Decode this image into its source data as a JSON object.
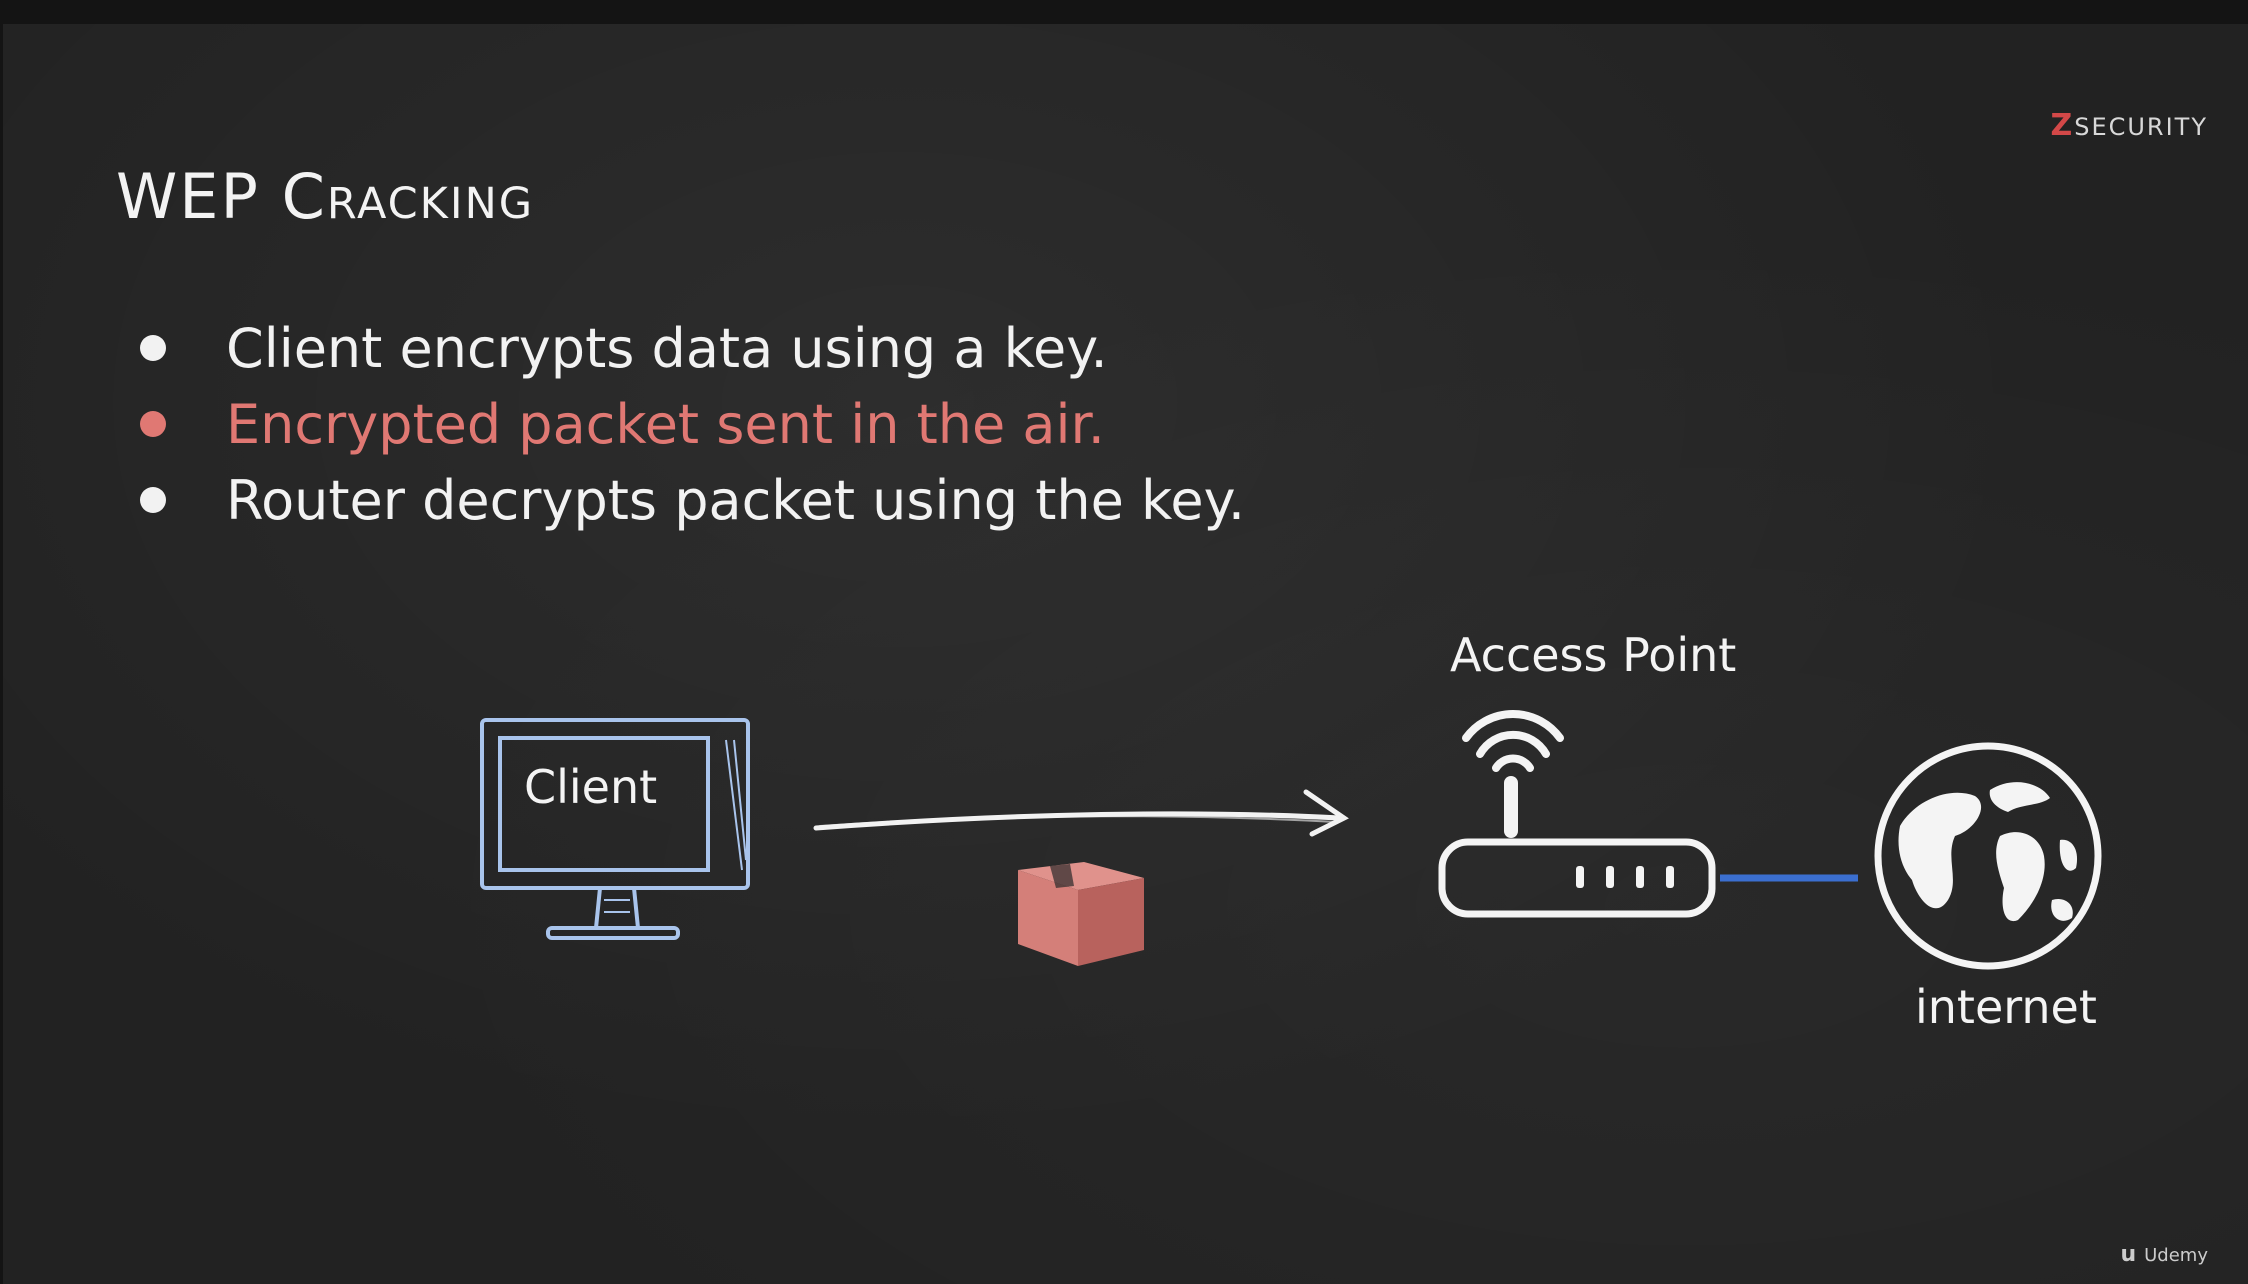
{
  "slide": {
    "title": "WEP Cracking",
    "bullets": [
      {
        "text": "Client encrypts data using a key.",
        "highlighted": false
      },
      {
        "text": "Encrypted packet sent in the air.",
        "highlighted": true
      },
      {
        "text": "Router decrypts packet using the key.",
        "highlighted": false
      }
    ]
  },
  "diagram": {
    "client_label": "Client",
    "access_point_label": "Access Point",
    "internet_label": "internet",
    "icons": [
      "monitor-icon",
      "packet-box-icon",
      "wifi-router-icon",
      "globe-icon",
      "arrow-icon"
    ]
  },
  "branding": {
    "zsecurity_prefix": "Z",
    "zsecurity_rest": "SECURITY",
    "udemy_glyph": "u",
    "udemy": "Udemy"
  },
  "colors": {
    "background": "#222222",
    "text": "#f2f2f2",
    "highlight": "#e07873",
    "monitor_blue": "#a9c4ec",
    "link_blue": "#3b6fd0",
    "packet": "#d47f79"
  }
}
